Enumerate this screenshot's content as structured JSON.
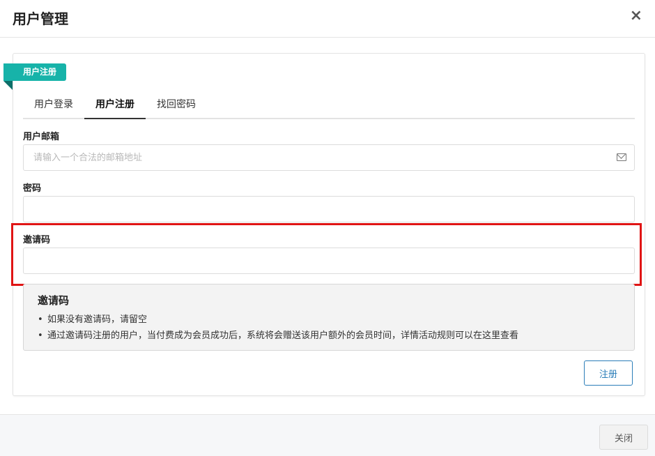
{
  "modal": {
    "title": "用户管理",
    "close_glyph": "×",
    "close_label": "关闭"
  },
  "ribbon": {
    "label": "用户注册"
  },
  "tabs": [
    {
      "label": "用户登录",
      "active": false
    },
    {
      "label": "用户注册",
      "active": true
    },
    {
      "label": "找回密码",
      "active": false
    }
  ],
  "form": {
    "email": {
      "label": "用户邮箱",
      "placeholder": "请输入一个合法的邮箱地址",
      "value": "",
      "icon": "mail-icon"
    },
    "password": {
      "label": "密码",
      "value": ""
    },
    "invite": {
      "label": "邀请码",
      "value": ""
    },
    "submit_label": "注册"
  },
  "info": {
    "title": "邀请码",
    "items": [
      "如果没有邀请码，请留空",
      "通过邀请码注册的用户，当付费成为会员成功后，系统将会赠送该用户额外的会员时间，详情活动规则可以在这里查看"
    ]
  },
  "colors": {
    "accent": "#17b3a9",
    "primary_button": "#2a7db8",
    "highlight": "#e01414"
  }
}
